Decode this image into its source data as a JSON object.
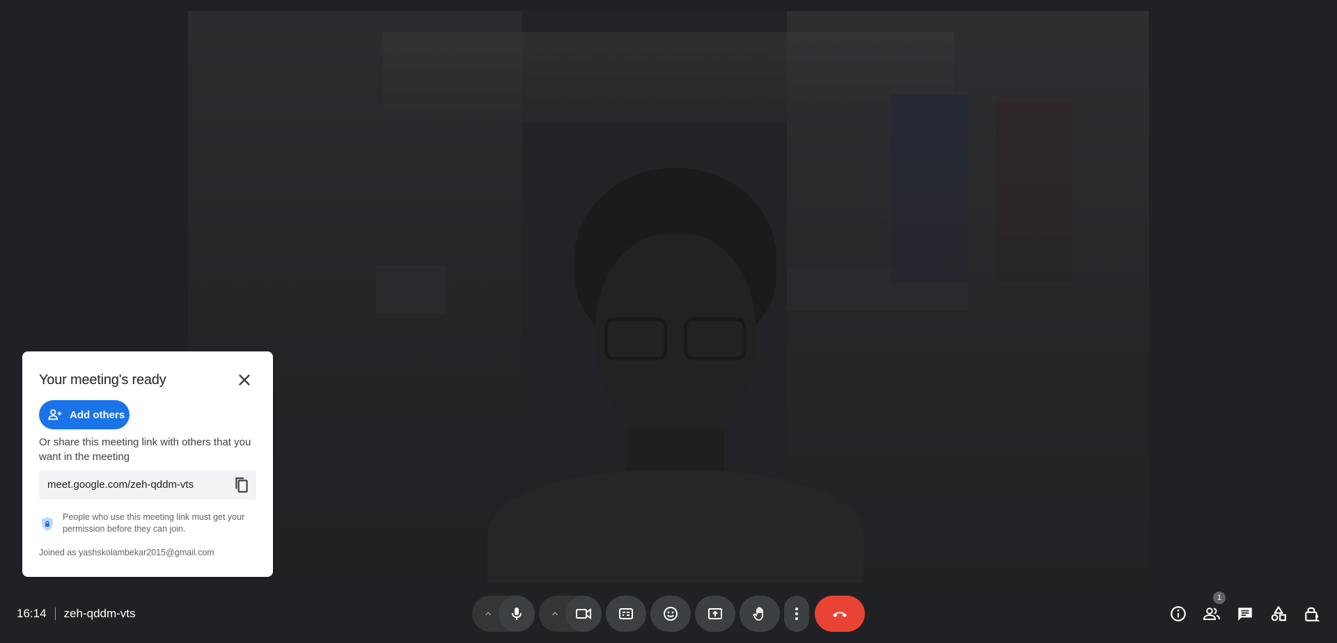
{
  "card": {
    "title": "Your meeting's ready",
    "add_others_label": "Add others",
    "description": "Or share this meeting link with others that you want in the meeting",
    "meeting_link": "meet.google.com/zeh-qddm-vts",
    "permission_note": "People who use this meeting link must get your permission before they can join.",
    "joined_as": "Joined as yashskolambekar2015@gmail.com"
  },
  "bottom_bar": {
    "time": "16:14",
    "meeting_code": "zeh-qddm-vts",
    "people_count": "1"
  },
  "icons": {
    "mic": "microphone-icon",
    "camera": "video-camera-icon",
    "captions": "closed-captions-icon",
    "reactions": "emoji-icon",
    "present": "present-screen-icon",
    "raise_hand": "raise-hand-icon",
    "more": "more-options-icon",
    "end_call": "end-call-icon",
    "info": "info-icon",
    "people": "people-icon",
    "chat": "chat-icon",
    "activities": "activities-icon",
    "host_controls": "lock-person-icon"
  },
  "colors": {
    "accent": "#1a73e8",
    "end_call": "#ea4335",
    "bar_background": "#202124"
  }
}
